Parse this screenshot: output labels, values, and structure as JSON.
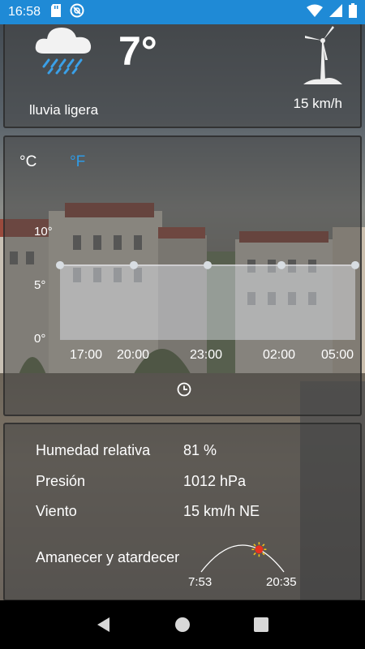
{
  "status_bar": {
    "time": "16:58",
    "icons": [
      "sd-card-icon",
      "vpn-icon"
    ],
    "right_icons": [
      "wifi-icon",
      "cellular-signal-icon",
      "battery-icon"
    ]
  },
  "current": {
    "icon": "rain-cloud-icon",
    "temperature": "7°",
    "condition": "lluvia ligera",
    "wind_icon": "wind-turbine-icon",
    "wind_speed": "15 km/h"
  },
  "chart_controls": {
    "unit_c": "°C",
    "unit_f": "°F",
    "active_unit": "°C",
    "active_color": "#2e9be6"
  },
  "chart_data": {
    "type": "area",
    "title": "",
    "xlabel": "",
    "ylabel": "",
    "y_ticks": [
      "10°",
      "5°",
      "0°"
    ],
    "x_ticks": [
      "17:00",
      "20:00",
      "23:00",
      "02:00",
      "05:00"
    ],
    "ylim": [
      0,
      12
    ],
    "grid": false,
    "series": [
      {
        "x": [
          "17:00",
          "20:00",
          "23:00",
          "02:00",
          "05:00"
        ],
        "values": [
          7,
          7,
          7,
          7,
          7
        ]
      }
    ]
  },
  "details": {
    "rows": [
      {
        "label": "Humedad relativa",
        "value": "81 %"
      },
      {
        "label": "Presión",
        "value": "1012 hPa"
      },
      {
        "label": "Viento",
        "value": "15 km/h NE"
      }
    ],
    "sun_label": "Amanecer y atardecer",
    "sunrise": "7:53",
    "sunset": "20:35",
    "sun_progress": 0.7
  },
  "nav": {
    "buttons": [
      "back-icon",
      "home-icon",
      "recents-icon"
    ]
  }
}
